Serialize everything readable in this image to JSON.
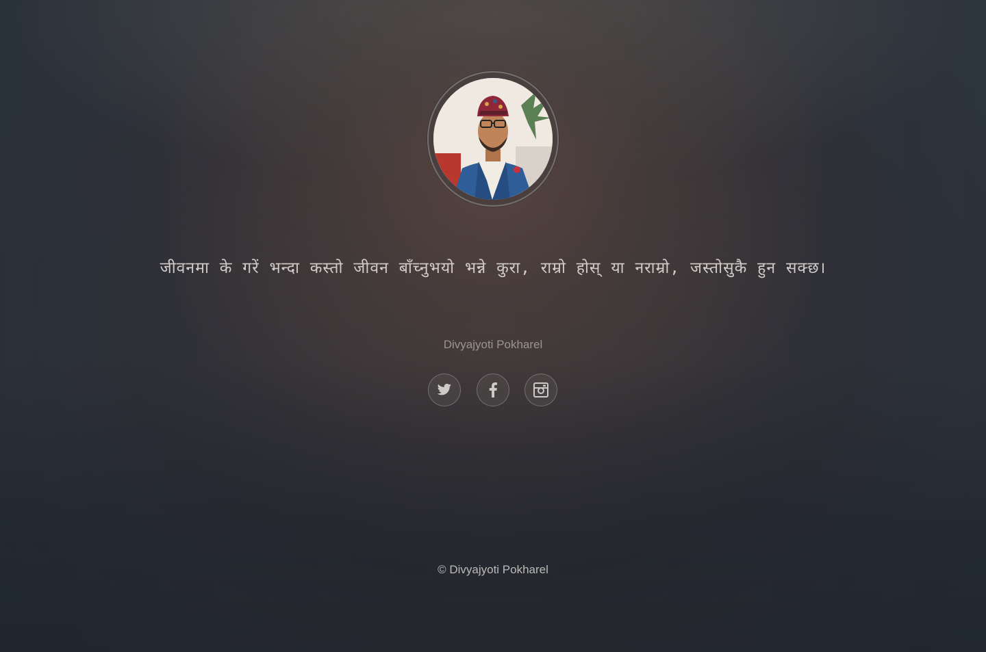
{
  "profile": {
    "quote": "जीवनमा के गरें भन्दा कस्तो जीवन बाँच्नुभयो भन्ने कुरा, राम्रो होस् या नराम्रो, जस्तोसुकै हुन सक्छ।",
    "author": "Divyajyoti Pokharel",
    "avatar_icon": "profile-photo"
  },
  "social": {
    "items": [
      {
        "name": "Twitter",
        "icon": "twitter-icon"
      },
      {
        "name": "Facebook",
        "icon": "facebook-icon"
      },
      {
        "name": "Instagram",
        "icon": "instagram-icon"
      }
    ]
  },
  "footer": {
    "copyright": "© Divyajyoti Pokharel"
  },
  "colors": {
    "text_primary": "#d2ccc8",
    "text_muted": "#9a9494",
    "icon": "#c9c5c3",
    "background_dark": "#262a35"
  }
}
